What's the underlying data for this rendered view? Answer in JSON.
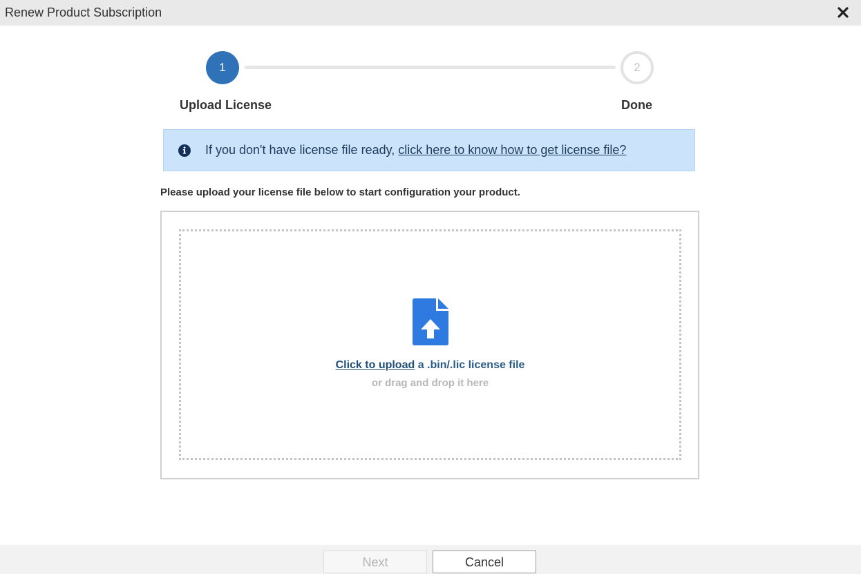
{
  "window": {
    "title": "Renew Product Subscription",
    "close_icon": "close-icon"
  },
  "stepper": {
    "steps": [
      {
        "number": "1",
        "label": "Upload License",
        "state": "active"
      },
      {
        "number": "2",
        "label": "Done",
        "state": "inactive"
      }
    ]
  },
  "info_banner": {
    "icon": "info-icon",
    "text": "If you don't have license file ready, ",
    "link_text": "click here to know how to get license file?"
  },
  "instructions": "Please upload your license file below to start configuration your product.",
  "upload": {
    "icon": "file-upload-icon",
    "link_text": "Click to upload",
    "text": " a .bin/.lic license file",
    "subtext": "or drag and drop it here"
  },
  "footer": {
    "next_label": "Next",
    "cancel_label": "Cancel"
  },
  "colors": {
    "accent": "#2f72b8",
    "icon_blue": "#2e7ae0",
    "info_bg": "#cce4fb",
    "titlebar_bg": "#e9e9e9"
  }
}
